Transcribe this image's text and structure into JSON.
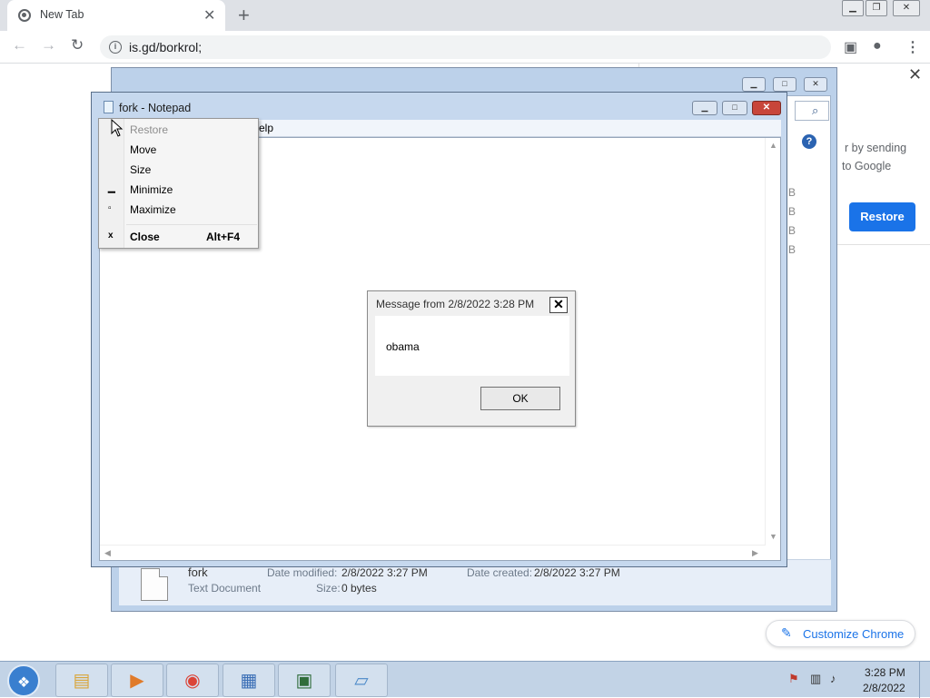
{
  "browser": {
    "tab_title": "New Tab",
    "url": "is.gd/borkrol;",
    "panel": {
      "text_line1": "r by sending",
      "text_line2": "to Google",
      "restore_label": "Restore"
    },
    "customize_label": "Customize Chrome"
  },
  "explorer": {
    "b_marks": [
      "B",
      "B",
      "B",
      "B"
    ],
    "help_glyph": "?",
    "details": {
      "file_name": "fork",
      "file_type": "Text Document",
      "date_modified_label": "Date modified:",
      "date_modified": "2/8/2022 3:27 PM",
      "date_created_label": "Date created:",
      "date_created": "2/8/2022 3:27 PM",
      "size_label": "Size:",
      "size": "0 bytes"
    }
  },
  "notepad": {
    "title": "fork - Notepad",
    "menu_partial": "elp"
  },
  "system_menu": {
    "items": [
      {
        "label": "Restore",
        "icon": "",
        "disabled": true
      },
      {
        "label": "Move",
        "icon": ""
      },
      {
        "label": "Size",
        "icon": ""
      },
      {
        "label": "Minimize",
        "icon": "minimize-icon"
      },
      {
        "label": "Maximize",
        "icon": "maximize-icon"
      },
      {
        "label": "Close",
        "icon": "close-icon",
        "shortcut": "Alt+F4"
      }
    ]
  },
  "message_box": {
    "title": "Message from  2/8/2022 3:28 PM",
    "text": "obama",
    "ok_label": "OK"
  },
  "taskbar": {
    "clock_time": "3:28 PM",
    "clock_date": "2/8/2022",
    "pinned": [
      "explorer-icon",
      "media-player-icon",
      "chrome-icon",
      "control-panel-icon",
      "console-icon",
      "notepad-icon"
    ]
  },
  "colors": {
    "accent_blue": "#1a73e8",
    "close_red": "#c8453a",
    "aero_frame": "#c6d8ee"
  }
}
